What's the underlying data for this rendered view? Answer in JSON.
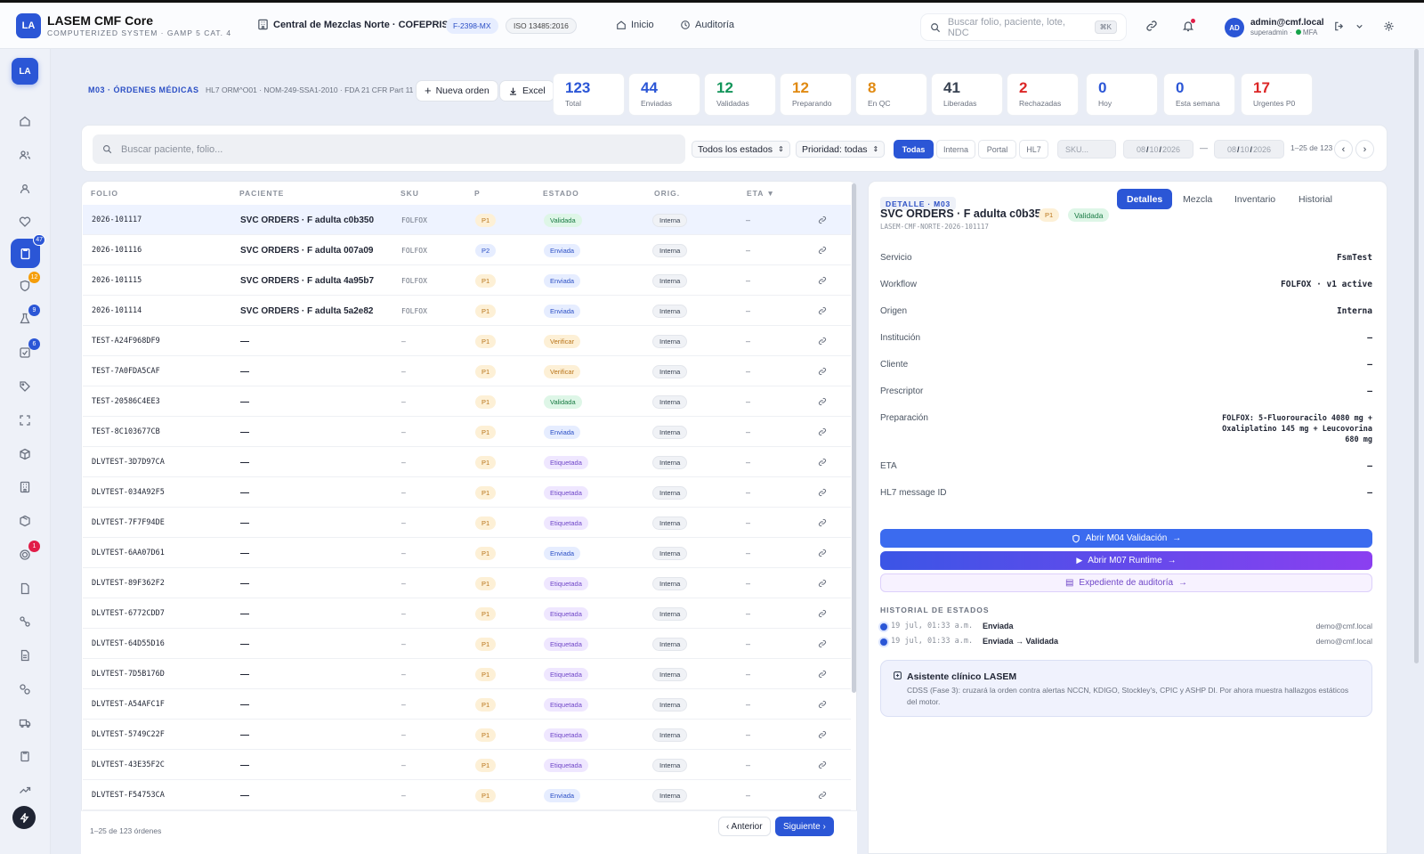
{
  "app": {
    "logo": "LA",
    "title": "LASEM CMF Core",
    "subtitle": "COMPUTERIZED SYSTEM · GAMP 5 CAT. 4",
    "site": "Central de Mezclas Norte · COFEPRIS F",
    "license": "F-2398-MX",
    "iso": "ISO 13485:2016"
  },
  "nav": {
    "home": "Inicio",
    "audit": "Auditoría"
  },
  "search": {
    "placeholder": "Buscar folio, paciente, lote, NDC",
    "shortcut": "⌘K"
  },
  "user": {
    "initials": "AD",
    "email": "admin@cmf.local",
    "role": "superadmin",
    "mfa": "MFA"
  },
  "sidebar": {
    "logo": "LA",
    "badges": {
      "orders": "47",
      "shield": "12",
      "flask": "9",
      "check": "6",
      "alert": "1"
    }
  },
  "module": {
    "title": "M03 · ÓRDENES MÉDICAS",
    "standards": "HL7 ORM^O01 · NOM-249-SSA1-2010 · FDA 21 CFR Part 11",
    "new_order": "Nueva orden",
    "excel": "Excel"
  },
  "kpis": [
    {
      "value": "123",
      "label": "Total",
      "color": "#2b56d6"
    },
    {
      "value": "44",
      "label": "Enviadas",
      "color": "#2b56d6"
    },
    {
      "value": "12",
      "label": "Validadas",
      "color": "#13955a"
    },
    {
      "value": "12",
      "label": "Preparando",
      "color": "#e08a12"
    },
    {
      "value": "8",
      "label": "En QC",
      "color": "#e08a12"
    },
    {
      "value": "41",
      "label": "Liberadas",
      "color": "#374151"
    },
    {
      "value": "2",
      "label": "Rechazadas",
      "color": "#dc2626"
    },
    {
      "value": "0",
      "label": "Hoy",
      "color": "#2b56d6"
    },
    {
      "value": "0",
      "label": "Esta semana",
      "color": "#2b56d6"
    },
    {
      "value": "17",
      "label": "Urgentes P0",
      "color": "#dc2626"
    }
  ],
  "filters": {
    "search_placeholder": "Buscar paciente, folio...",
    "status": "Todos los estados",
    "priority": "Prioridad: todas",
    "origins": [
      "Todas",
      "Interna",
      "Portal",
      "HL7"
    ],
    "sku_placeholder": "SKU...",
    "date_from": {
      "m": "08",
      "d": "10",
      "y": "2026"
    },
    "date_to": {
      "m": "08",
      "d": "10",
      "y": "2026"
    },
    "date_sep": "—",
    "range": "1–25 de 123"
  },
  "table": {
    "headers": [
      "FOLIO",
      "PACIENTE",
      "SKU",
      "P",
      "ESTADO",
      "ORIG.",
      "ETA ▼"
    ],
    "rows": [
      {
        "folio": "2026-101117",
        "paciente": "SVC ORDERS · F adulta c0b350",
        "sku": "FOLFOX",
        "p": "P1",
        "estado": "Validada",
        "orig": "Interna",
        "eta": "–"
      },
      {
        "folio": "2026-101116",
        "paciente": "SVC ORDERS · F adulta 007a09",
        "sku": "FOLFOX",
        "p": "P2",
        "estado": "Enviada",
        "orig": "Interna",
        "eta": "–"
      },
      {
        "folio": "2026-101115",
        "paciente": "SVC ORDERS · F adulta 4a95b7",
        "sku": "FOLFOX",
        "p": "P1",
        "estado": "Enviada",
        "orig": "Interna",
        "eta": "–"
      },
      {
        "folio": "2026-101114",
        "paciente": "SVC ORDERS · F adulta 5a2e82",
        "sku": "FOLFOX",
        "p": "P1",
        "estado": "Enviada",
        "orig": "Interna",
        "eta": "–"
      },
      {
        "folio": "TEST-A24F968DF9",
        "paciente": "—",
        "sku": "–",
        "p": "P1",
        "estado": "Verificar",
        "orig": "Interna",
        "eta": "–"
      },
      {
        "folio": "TEST-7A0FDA5CAF",
        "paciente": "—",
        "sku": "–",
        "p": "P1",
        "estado": "Verificar",
        "orig": "Interna",
        "eta": "–"
      },
      {
        "folio": "TEST-20586C4EE3",
        "paciente": "—",
        "sku": "–",
        "p": "P1",
        "estado": "Validada",
        "orig": "Interna",
        "eta": "–"
      },
      {
        "folio": "TEST-8C103677CB",
        "paciente": "—",
        "sku": "–",
        "p": "P1",
        "estado": "Enviada",
        "orig": "Interna",
        "eta": "–"
      },
      {
        "folio": "DLVTEST-3D7D97CA",
        "paciente": "—",
        "sku": "–",
        "p": "P1",
        "estado": "Etiquetada",
        "orig": "Interna",
        "eta": "–"
      },
      {
        "folio": "DLVTEST-034A92F5",
        "paciente": "—",
        "sku": "–",
        "p": "P1",
        "estado": "Etiquetada",
        "orig": "Interna",
        "eta": "–"
      },
      {
        "folio": "DLVTEST-7F7F94DE",
        "paciente": "—",
        "sku": "–",
        "p": "P1",
        "estado": "Etiquetada",
        "orig": "Interna",
        "eta": "–"
      },
      {
        "folio": "DLVTEST-6AA07D61",
        "paciente": "—",
        "sku": "–",
        "p": "P1",
        "estado": "Enviada",
        "orig": "Interna",
        "eta": "–"
      },
      {
        "folio": "DLVTEST-89F362F2",
        "paciente": "—",
        "sku": "–",
        "p": "P1",
        "estado": "Etiquetada",
        "orig": "Interna",
        "eta": "–"
      },
      {
        "folio": "DLVTEST-6772CDD7",
        "paciente": "—",
        "sku": "–",
        "p": "P1",
        "estado": "Etiquetada",
        "orig": "Interna",
        "eta": "–"
      },
      {
        "folio": "DLVTEST-64D55D16",
        "paciente": "—",
        "sku": "–",
        "p": "P1",
        "estado": "Etiquetada",
        "orig": "Interna",
        "eta": "–"
      },
      {
        "folio": "DLVTEST-7D5B176D",
        "paciente": "—",
        "sku": "–",
        "p": "P1",
        "estado": "Etiquetada",
        "orig": "Interna",
        "eta": "–"
      },
      {
        "folio": "DLVTEST-A54AFC1F",
        "paciente": "—",
        "sku": "–",
        "p": "P1",
        "estado": "Etiquetada",
        "orig": "Interna",
        "eta": "–"
      },
      {
        "folio": "DLVTEST-5749C22F",
        "paciente": "—",
        "sku": "–",
        "p": "P1",
        "estado": "Etiquetada",
        "orig": "Interna",
        "eta": "–"
      },
      {
        "folio": "DLVTEST-43E35F2C",
        "paciente": "—",
        "sku": "–",
        "p": "P1",
        "estado": "Etiquetada",
        "orig": "Interna",
        "eta": "–"
      },
      {
        "folio": "DLVTEST-F54753CA",
        "paciente": "—",
        "sku": "–",
        "p": "P1",
        "estado": "Enviada",
        "orig": "Interna",
        "eta": "–"
      }
    ],
    "footer": "1–25 de 123 órdenes",
    "prev": "‹ Anterior",
    "next": "Siguiente ›"
  },
  "detail": {
    "chip": "DETALLE · M03",
    "title": "SVC ORDERS · F adulta c0b350",
    "priority": "P1",
    "status": "Validada",
    "folio": "LASEM-CMF-NORTE-2026-101117",
    "tabs": [
      "Detalles",
      "Mezcla",
      "Inventario",
      "Historial"
    ],
    "fields": [
      {
        "k": "Servicio",
        "v": "FsmTest"
      },
      {
        "k": "Workflow",
        "v": "FOLFOX · v1 active"
      },
      {
        "k": "Origen",
        "v": "Interna"
      },
      {
        "k": "Institución",
        "v": "—"
      },
      {
        "k": "Cliente",
        "v": "—"
      },
      {
        "k": "Prescriptor",
        "v": "—"
      },
      {
        "k": "Preparación",
        "v": "FOLFOX: 5-Fluorouracilo 4080 mg + Oxaliplatino 145 mg + Leucovorina 680 mg"
      },
      {
        "k": "ETA",
        "v": "—"
      },
      {
        "k": "HL7 message ID",
        "v": "—"
      }
    ],
    "actions": {
      "m04": "Abrir M04 Validación",
      "m07": "Abrir M07 Runtime",
      "audit": "Expediente de auditoría"
    },
    "history_title": "HISTORIAL DE ESTADOS",
    "history": [
      {
        "time": "19 jul, 01:33 a.m.",
        "event": "Enviada",
        "user": "demo@cmf.local"
      },
      {
        "time": "19 jul, 01:33 a.m.",
        "event": "Enviada → Validada",
        "user": "demo@cmf.local"
      }
    ],
    "assistant": {
      "title": "Asistente clínico LASEM",
      "desc": "CDSS (Fase 3): cruzará la orden contra alertas NCCN, KDIGO, Stockley's, CPIC y ASHP DI. Por ahora muestra hallazgos estáticos del motor."
    }
  }
}
